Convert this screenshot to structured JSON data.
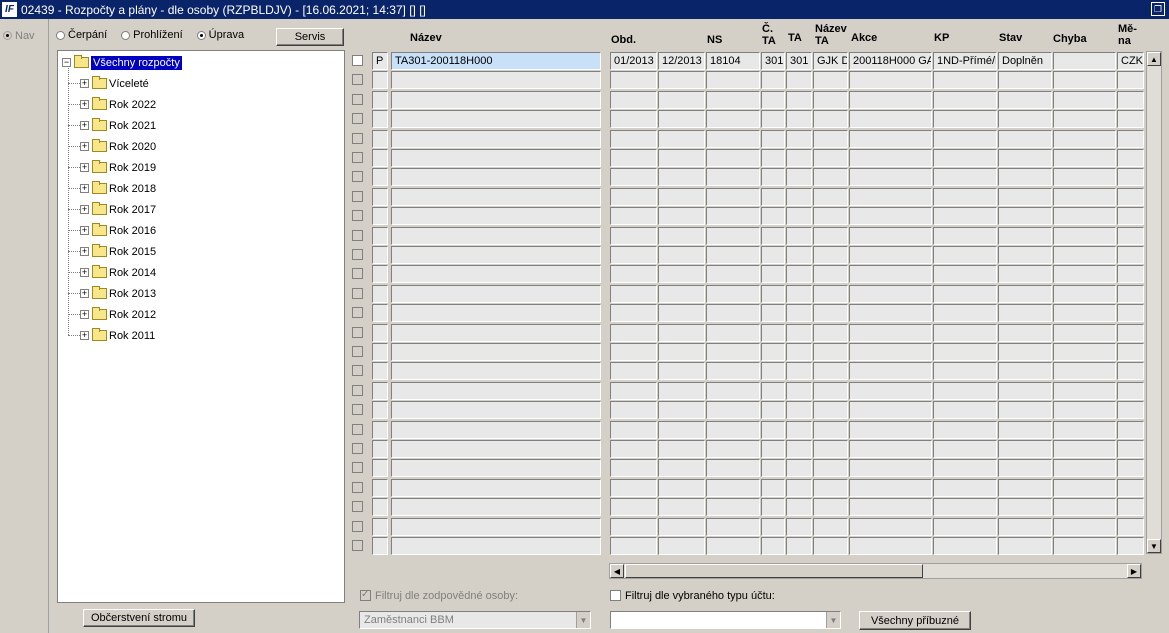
{
  "window": {
    "title": "02439 - Rozpočty a plány - dle osoby (RZPBLDJV) - [16.06.2021; 14:37] [] []"
  },
  "nav": {
    "label": "Nav"
  },
  "modes": {
    "cerpani": "Čerpání",
    "prohlizeni": "Prohlížení",
    "uprava": "Úprava",
    "selected": "uprava"
  },
  "servis_button": "Servis",
  "refresh_tree_button": "Občerstvení stromu",
  "tree": {
    "root": "Všechny rozpočty",
    "items": [
      "Víceleté",
      "Rok 2022",
      "Rok 2021",
      "Rok 2020",
      "Rok 2019",
      "Rok 2018",
      "Rok 2017",
      "Rok 2016",
      "Rok 2015",
      "Rok 2014",
      "Rok 2013",
      "Rok 2012",
      "Rok 2011"
    ]
  },
  "grid": {
    "headers": {
      "nazev": "Název",
      "obd": "Obd.",
      "ns": "NS",
      "c": "Č.",
      "c2": "TA",
      "ta": "TA",
      "nazev_ta1": "Název",
      "nazev_ta2": "TA",
      "akce": "Akce",
      "kp": "KP",
      "stav": "Stav",
      "chyba": "Chyba",
      "mena1": "Mě-",
      "mena2": "na"
    },
    "first_row": {
      "p": "P",
      "nazev": "TA301-200118H000",
      "obd_od": "01/2013",
      "obd_do": "12/2013",
      "ns": "18104",
      "c_ta": "301",
      "ta": "301",
      "nazev_ta": "GJK D",
      "akce": "200118H000 GA",
      "kp": "1ND-Přímé/N",
      "stav": "Doplněn",
      "chyba": "",
      "mena": "CZK"
    },
    "empty_rows": 25
  },
  "filters": {
    "osoby_label": "Filtruj dle zodpovědné osoby:",
    "osoby_value": "Zaměstnanci BBM",
    "ucet_label": "Filtruj dle vybraného typu účtu:",
    "ucet_value": ""
  },
  "related_button": "Všechny příbuzné"
}
